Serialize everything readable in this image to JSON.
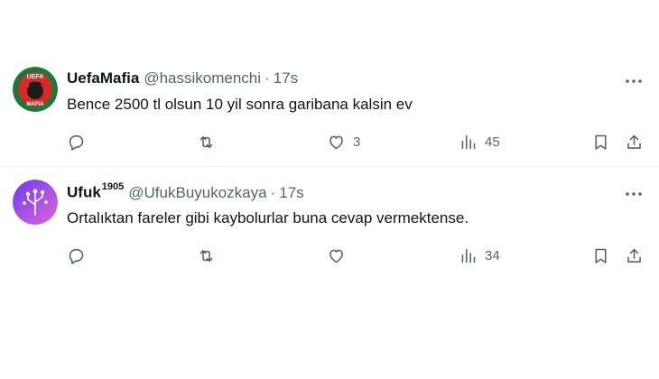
{
  "tweets": [
    {
      "display_name": "UefaMafia",
      "handle": "@hassikomenchi",
      "separator": "·",
      "time": "17s",
      "text": "Bence 2500 tl olsun 10 yil sonra garibana kalsin ev",
      "avatar": {
        "label_top": "UEFA",
        "label_bottom": "MAFIA",
        "colors": [
          "#1a7a3a",
          "#d42a2a"
        ]
      },
      "reply_count": "",
      "retweet_count": "",
      "like_count": "3",
      "view_count": "45"
    },
    {
      "display_name": "Ufuk",
      "name_suffix": "1905",
      "handle": "@UfukBuyukozkaya",
      "separator": "·",
      "time": "17s",
      "text": "Ortalıktan fareler gibi kaybolurlar buna cevap vermektense.",
      "avatar": {
        "colors": [
          "#6b3cf0",
          "#e064d8"
        ]
      },
      "reply_count": "",
      "retweet_count": "",
      "like_count": "",
      "view_count": "34"
    }
  ],
  "icons": [
    "more-icon",
    "reply-icon",
    "retweet-icon",
    "like-icon",
    "views-icon",
    "bookmark-icon",
    "share-icon"
  ],
  "colors": {
    "text": "#0f1419",
    "secondary": "#536471",
    "divider": "#eff3f4"
  }
}
